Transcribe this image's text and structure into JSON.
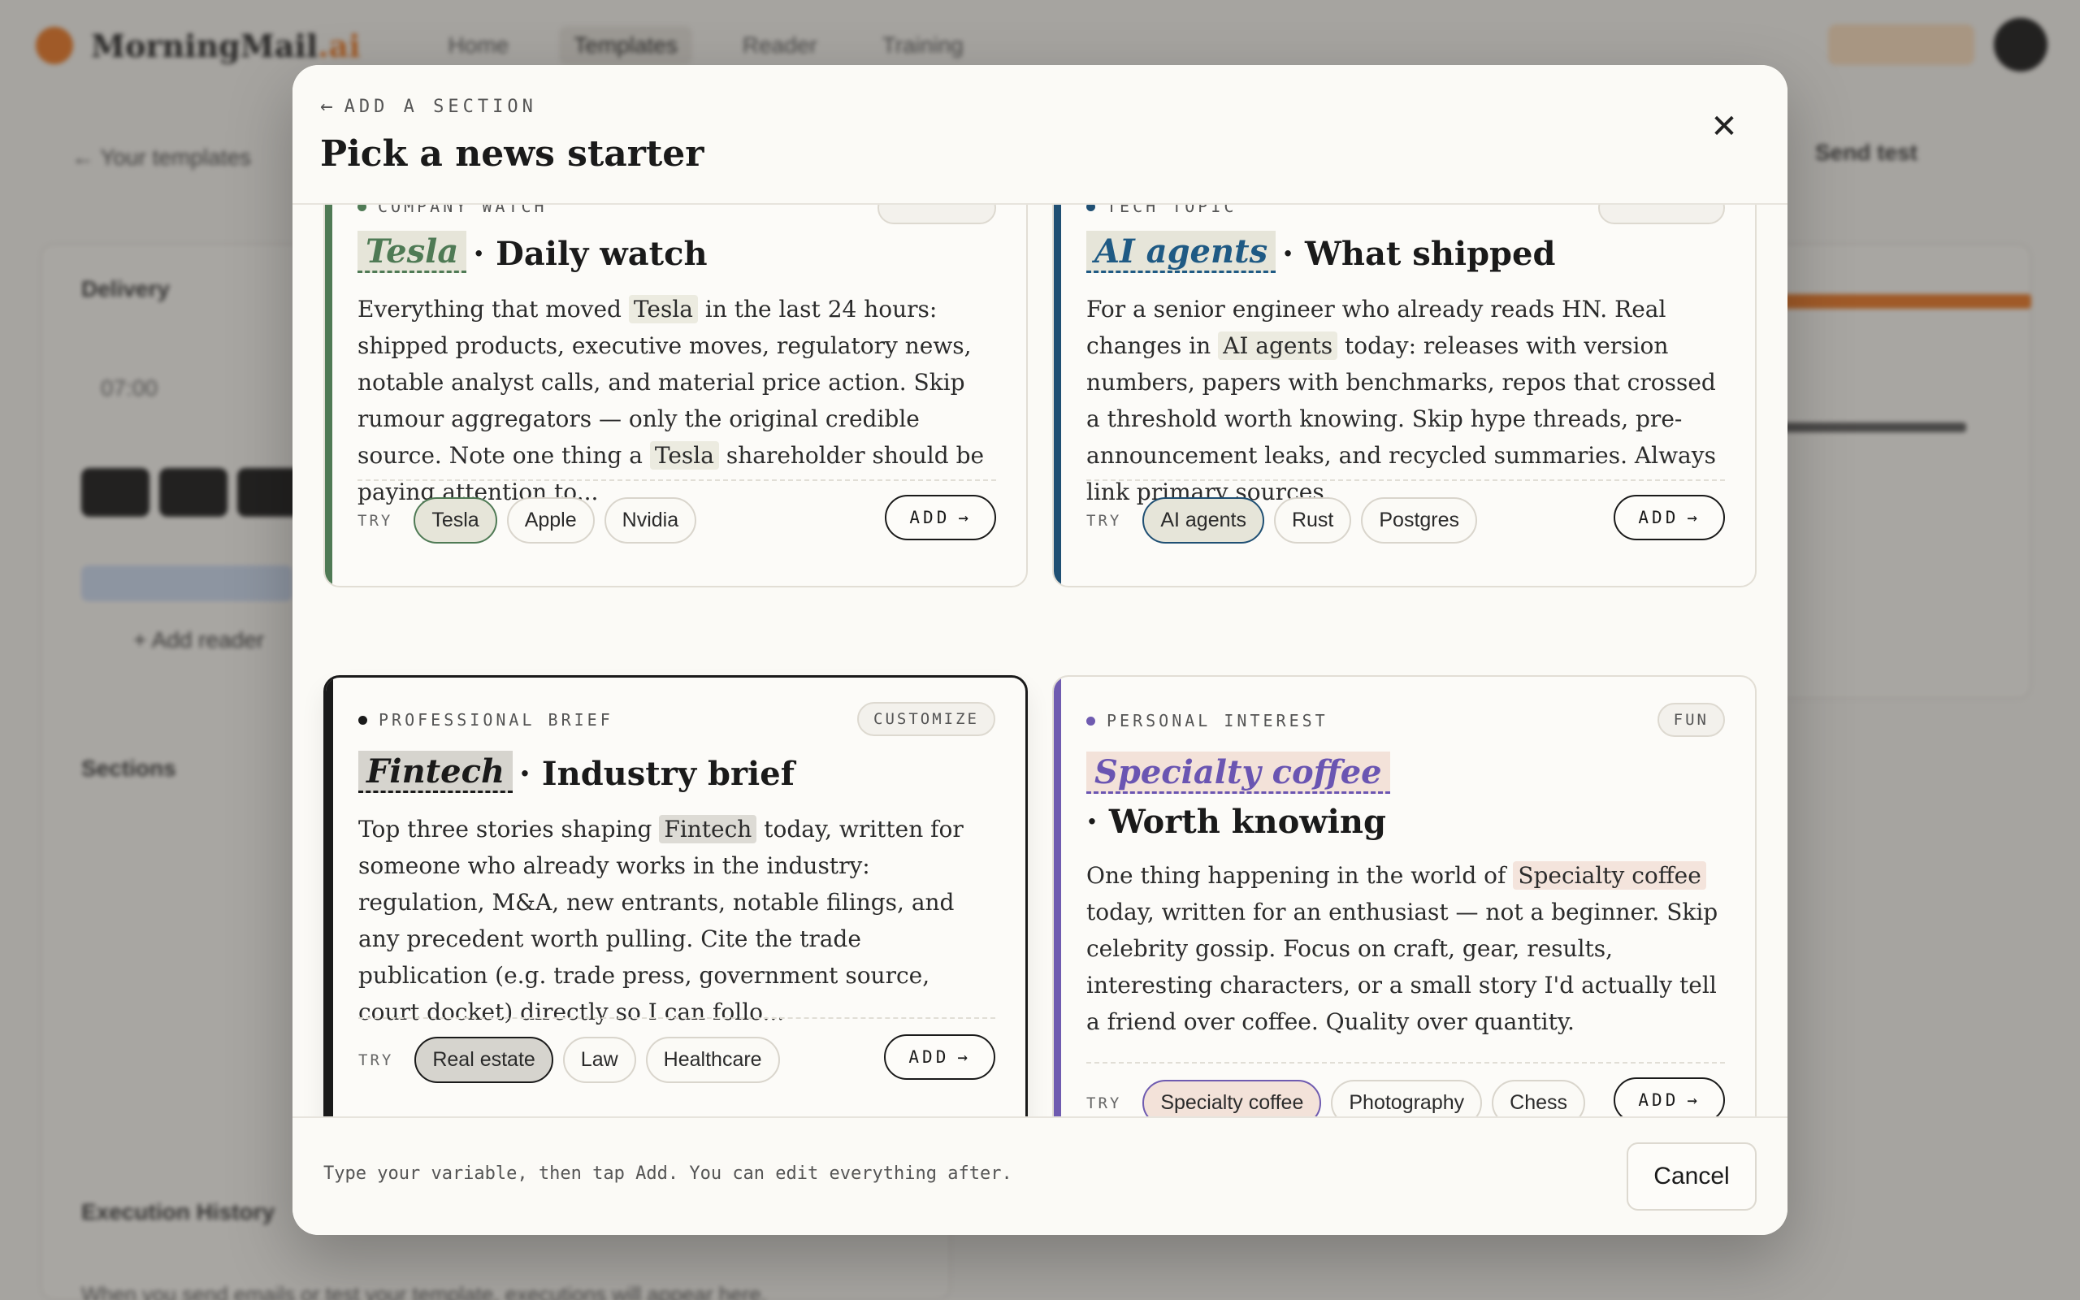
{
  "background": {
    "brand": "MorningMail",
    "brand_suffix": ".ai",
    "nav": [
      "Home",
      "Templates",
      "Reader",
      "Training"
    ],
    "back_label": "← Your templates",
    "send_test_label": "Send test",
    "delivery_label": "Delivery",
    "time_value": "07:00",
    "sections_label": "Sections",
    "add_reader_label": "+ Add reader",
    "execution_history_label": "Execution History",
    "execution_history_text": "When you send emails or test your template, executions will appear here."
  },
  "modal": {
    "back_label": "ADD A SECTION",
    "title": "Pick a news starter",
    "footer_hint": "Type your variable, then tap Add. You can edit everything after.",
    "cancel_label": "Cancel"
  },
  "cards": [
    {
      "eyebrow": "COMPANY WATCH",
      "badge": "",
      "variable": "Tesla",
      "title_rest": "Daily watch",
      "desc_parts": [
        "Everything that moved ",
        "Tesla",
        " in the last 24 hours: shipped products, executive moves, regulatory news, notable analyst calls, and material price action. Skip rumour aggregators — only the original credible source. Note one thing a ",
        "Tesla",
        " shareholder should be paying attention to..."
      ],
      "try_label": "TRY",
      "chips": [
        "Tesla",
        "Apple",
        "Nvidia"
      ],
      "add_label": "ADD",
      "accent": "#4f7a55",
      "var_bg": "#e6e5d9",
      "var_color": "#4f7a55",
      "var_underline": "#4f7a55",
      "hl_bg": "#ecebe0"
    },
    {
      "eyebrow": "TECH TOPIC",
      "badge": "",
      "variable": "AI agents",
      "title_rest": "What shipped",
      "desc_parts": [
        "For a senior engineer who already reads HN. Real changes in ",
        "AI agents",
        " today: releases with version numbers, papers with benchmarks, repos that crossed a threshold worth knowing. Skip hype threads, pre-announcement leaks, and recycled summaries. Always link primary sources."
      ],
      "try_label": "TRY",
      "chips": [
        "AI agents",
        "Rust",
        "Postgres"
      ],
      "add_label": "ADD",
      "accent": "#1f4f73",
      "var_bg": "#e6e5d9",
      "var_color": "#1f5a84",
      "var_underline": "#1f5a84",
      "hl_bg": "#ecebe0"
    },
    {
      "eyebrow": "PROFESSIONAL BRIEF",
      "badge": "CUSTOMIZE",
      "variable": "Fintech",
      "title_rest": "Industry brief",
      "desc_parts": [
        "Top three stories shaping ",
        "Fintech",
        " today, written for someone who already works in the industry: regulation, M&A, new entrants, notable filings, and any precedent worth pulling. Cite the trade publication (e.g. trade press, government source, court docket) directly so I can follo..."
      ],
      "try_label": "TRY",
      "chips": [
        "Real estate",
        "Law",
        "Healthcare"
      ],
      "add_label": "ADD",
      "accent": "#1a1a1a",
      "var_bg": "#d6d4ce",
      "var_color": "#1a1a1a",
      "var_underline": "#1a1a1a",
      "hl_bg": "#dddbd5"
    },
    {
      "eyebrow": "PERSONAL INTEREST",
      "badge": "FUN",
      "variable": "Specialty coffee",
      "title_rest": "Worth knowing",
      "desc_parts": [
        "One thing happening in the world of ",
        "Specialty coffee",
        " today, written for an enthusiast — not a beginner. Skip celebrity gossip. Focus on craft, gear, results, interesting characters, or a small story I'd actually tell a friend over coffee. Quality over quantity."
      ],
      "try_label": "TRY",
      "chips": [
        "Specialty coffee",
        "Photography",
        "Chess"
      ],
      "add_label": "ADD",
      "accent": "#6f5bb0",
      "var_bg": "#f3e2d9",
      "var_color": "#6a55b2",
      "var_underline": "#6a55b2",
      "hl_bg": "#f4e4dc"
    }
  ]
}
